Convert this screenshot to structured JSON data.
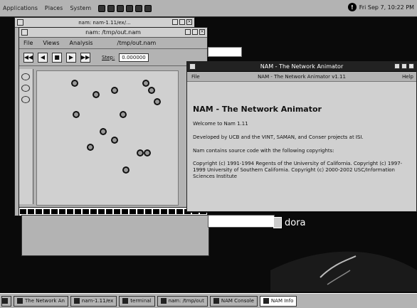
{
  "top_panel": {
    "menus": [
      "Applications",
      "Places",
      "System"
    ],
    "clock": "Fri Sep 7, 10:22 PM"
  },
  "console_window": {
    "title": "nam: nam-1.11/ex/..."
  },
  "nam_window": {
    "title": "nam: /tmp/out.nam",
    "menus": [
      "File",
      "Views",
      "Analysis"
    ],
    "file_label": "/tmp/out.nam",
    "controls": [
      "◀◀",
      "◀",
      "■",
      "▶",
      "▶▶"
    ],
    "step_label": "Step:",
    "time_value": "0.000000"
  },
  "info_window": {
    "title": "NAM - The Network Animator",
    "subtitle": "NAM - The Network Animator v1.11",
    "subbar_left": "File",
    "subbar_right": "Help",
    "heading": "NAM - The Network Animator",
    "paragraphs": [
      "Welcome to Nam 1.11",
      "Developed by UCB and the VINT, SAMAN, and Conser projects at ISI.",
      "Nam contains source code with the following copyrights:",
      "Copyright (c) 1991-1994 Regents of the University of California. Copyright (c) 1997-1999 University of Southern California. Copyright (c) 2000-2002 USC/Information Sciences Institute"
    ]
  },
  "desktop": {
    "label": "dora"
  },
  "taskbar": {
    "tasks": [
      {
        "label": "The Network An",
        "active": false
      },
      {
        "label": "nam-1.11/ex",
        "active": false
      },
      {
        "label": "terminal",
        "active": false
      },
      {
        "label": "nam: /tmp/out",
        "active": false
      },
      {
        "label": "NAM Console",
        "active": false
      },
      {
        "label": "NAM Info",
        "active": true
      }
    ]
  },
  "colors": {
    "desktop": "#0a0a0a",
    "window_gray": "#c8c8c8",
    "active_titlebar": "#222222"
  }
}
